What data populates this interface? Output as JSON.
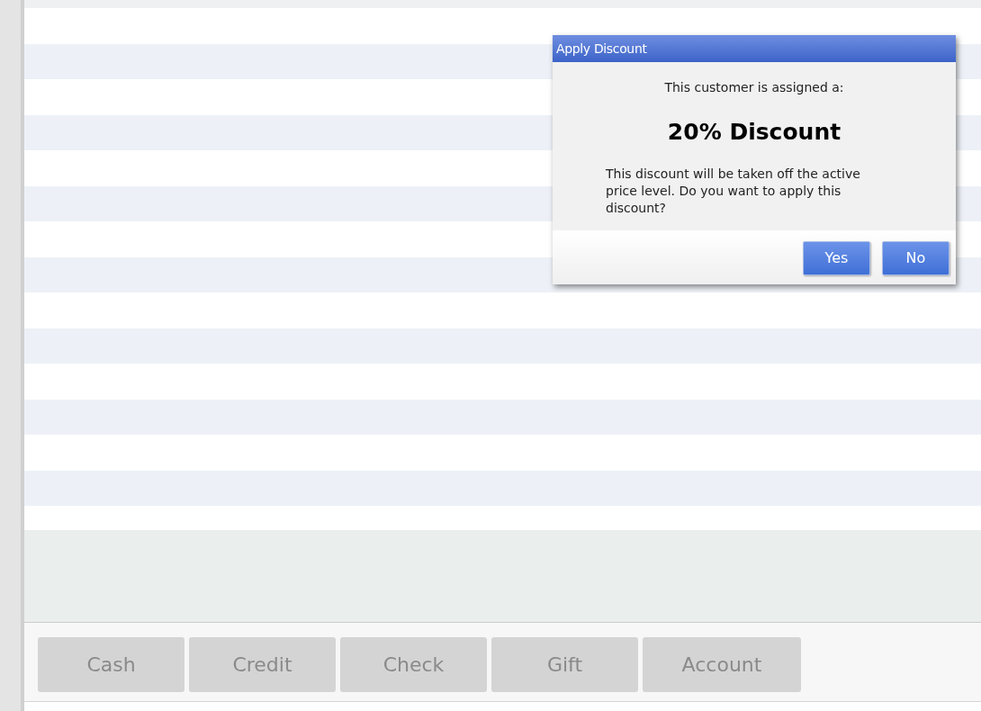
{
  "dialog": {
    "title": "Apply Discount",
    "intro": "This customer is assigned a:",
    "discount": "20% Discount",
    "message": "This discount will be taken off the active price level. Do you want to apply this discount?",
    "buttons": [
      {
        "label": "Yes"
      },
      {
        "label": "No"
      }
    ]
  },
  "payment_buttons": [
    {
      "label": "Cash",
      "disabled": true
    },
    {
      "label": "Credit",
      "disabled": true
    },
    {
      "label": "Check",
      "disabled": true
    },
    {
      "label": "Gift",
      "disabled": true
    },
    {
      "label": "Account",
      "disabled": true
    }
  ]
}
